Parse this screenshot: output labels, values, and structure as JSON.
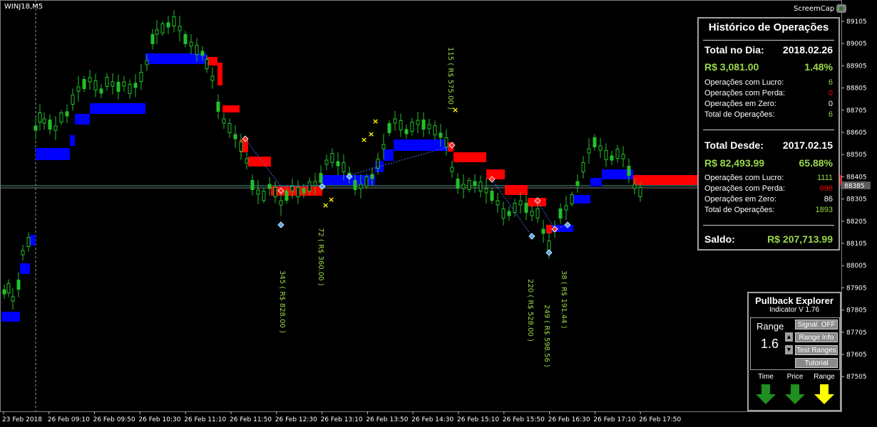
{
  "header": {
    "symbol": "WINJ18,M5",
    "screencap_label": "ScreemCap"
  },
  "colors": {
    "background": "#000000",
    "candle_green": "#22c02a",
    "band_blue": "#0000ff",
    "band_red": "#ff0000",
    "label_green": "#9ad94a",
    "marker_yellow": "#ffff00",
    "text_white": "#ffffff"
  },
  "chart_data": {
    "type": "candlestick",
    "y_ticks": [
      "89105",
      "89005",
      "88905",
      "88805",
      "88705",
      "88605",
      "88505",
      "88405",
      "88305",
      "88205",
      "88105",
      "88005",
      "87905",
      "87805",
      "87705",
      "87605",
      "87505"
    ],
    "current_price_label": "88385",
    "x_ticks": [
      "23 Feb 2018",
      "26 Feb 09:10",
      "26 Feb 09:50",
      "26 Feb 10:30",
      "26 Feb 11:10",
      "26 Feb 11:50",
      "26 Feb 12:30",
      "26 Feb 13:10",
      "26 Feb 13:50",
      "26 Feb 14:30",
      "26 Feb 15:10",
      "26 Feb 15:50",
      "26 Feb 16:30",
      "26 Feb 17:10",
      "26 Feb 17:50"
    ],
    "trade_labels": [
      {
        "text": "345 ( R$ 828.00 )"
      },
      {
        "text": "72 ( R$ 360.00 )"
      },
      {
        "text": "115 ( R$ 575.00 )"
      },
      {
        "text": "220 ( R$ 528.00 )"
      },
      {
        "text": "249 ( R$ 598.56 )"
      },
      {
        "text": "38 ( R$ 191.44 )"
      }
    ],
    "grid": false
  },
  "historico": {
    "title": "Histórico de Operações",
    "day_label": "Total no Dia:",
    "day_date": "2018.02.26",
    "day_value": "R$ 3,081.00",
    "day_pct": "1.48%",
    "day_rows": [
      {
        "label": "Operações com Lucro:",
        "value": "6",
        "color": "#9ad94a"
      },
      {
        "label": "Operações com Perda:",
        "value": "0",
        "color": "#ff0000"
      },
      {
        "label": "Operações em Zero:",
        "value": "0",
        "color": "#ffffff"
      },
      {
        "label": "Total de Operações:",
        "value": "6",
        "color": "#9ad94a"
      }
    ],
    "since_label": "Total Desde:",
    "since_date": "2017.02.15",
    "since_value": "R$ 82,493.99",
    "since_pct": "65.88%",
    "since_rows": [
      {
        "label": "Operações com Lucro:",
        "value": "1111",
        "color": "#9ad94a"
      },
      {
        "label": "Operações com Perda:",
        "value": "696",
        "color": "#ff0000"
      },
      {
        "label": "Operações em Zero:",
        "value": "86",
        "color": "#ffffff"
      },
      {
        "label": "Total de Operações:",
        "value": "1893",
        "color": "#9ad94a"
      }
    ],
    "saldo_label": "Saldo:",
    "saldo_value": "R$ 207,713.99"
  },
  "pullback": {
    "title": "Pullback Explorer",
    "subtitle": "Indicator V 1.76",
    "range_label": "Range",
    "range_value": "1.6",
    "buttons": [
      "Signal: OFF",
      "Range Info",
      "Test Ranges",
      "Tutorial"
    ],
    "indicators": [
      {
        "label": "Time",
        "icon": "arrow-down-icon",
        "color": "#1f8f1f"
      },
      {
        "label": "Price",
        "icon": "arrow-down-icon",
        "color": "#1f8f1f"
      },
      {
        "label": "Range",
        "icon": "arrow-down-icon",
        "color": "#ffff00"
      }
    ]
  }
}
